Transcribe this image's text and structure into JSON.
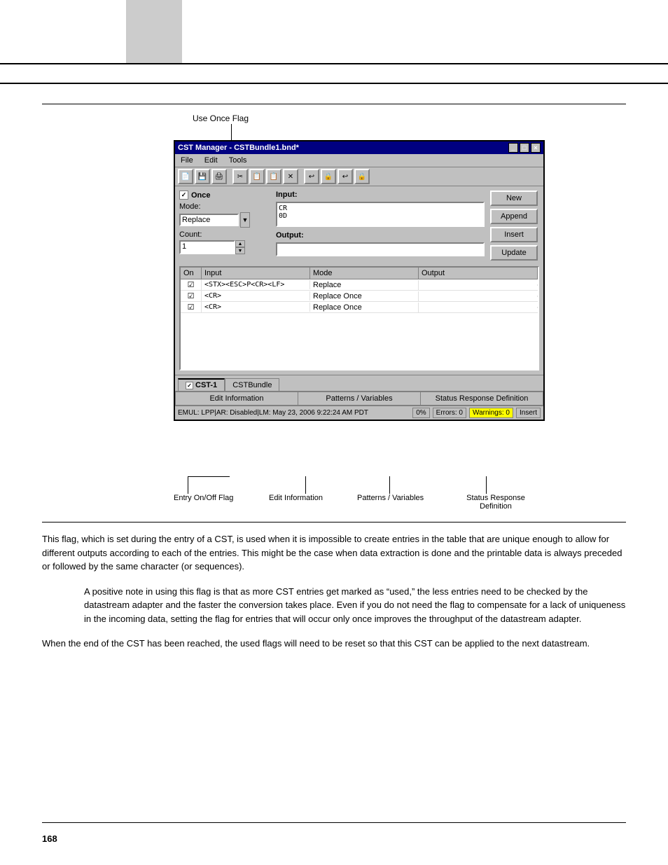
{
  "page": {
    "number": "168"
  },
  "window": {
    "title": "CST Manager - CSTBundle1.bnd*",
    "controls": [
      "_",
      "□",
      "×"
    ]
  },
  "menu": {
    "items": [
      "File",
      "Edit",
      "Tools"
    ]
  },
  "toolbar": {
    "buttons": [
      "📄",
      "💾",
      "🖨",
      "✂",
      "📋",
      "📋",
      "✕",
      "📋",
      "↩",
      "🔒"
    ]
  },
  "once_checkbox": {
    "label": "Once",
    "checked": true
  },
  "mode": {
    "label": "Mode:",
    "value": "Replace"
  },
  "count": {
    "label": "Count:",
    "value": "1"
  },
  "input_section": {
    "label": "Input:",
    "lines": [
      "CR",
      "0D"
    ]
  },
  "output_section": {
    "label": "Output:",
    "value": ""
  },
  "action_buttons": {
    "new": "New",
    "append": "Append",
    "insert": "Insert",
    "update": "Update"
  },
  "table": {
    "headers": [
      "On",
      "Input",
      "Mode",
      "Output"
    ],
    "rows": [
      {
        "on": "☑",
        "input": "<STX><ESC>P<CR><LF>",
        "mode": "Replace",
        "output": ""
      },
      {
        "on": "☑",
        "input": "<CR>",
        "mode": "Replace Once",
        "output": ""
      },
      {
        "on": "☑",
        "input": "<CR>",
        "mode": "Replace Once",
        "output": ""
      }
    ]
  },
  "tabs": [
    {
      "label": "CST-1",
      "checked": true,
      "active": true
    },
    {
      "label": "CSTBundle",
      "checked": false,
      "active": false
    }
  ],
  "bottom_tabs": [
    {
      "label": "Edit Information"
    },
    {
      "label": "Patterns / Variables"
    },
    {
      "label": "Status Response Definition"
    }
  ],
  "status_bar": {
    "text": "EMUL: LPP|AR: Disabled|LM: May 23, 2006 9:22:24 AM PDT",
    "percent": "0%",
    "errors": "Errors: 0",
    "warnings": "Warnings: 0",
    "insert": "Insert"
  },
  "annotations": {
    "use_once_flag": "Use Once Flag",
    "entry_on_off": "Entry On/Off Flag",
    "edit_information": "Edit Information",
    "patterns_variables": "Patterns / Variables",
    "status_response": "Status Response\nDefinition"
  },
  "body_text": {
    "paragraph1": "This flag, which is set during the entry of a CST, is used when it is impossible to create entries in the table that are unique enough to allow for different outputs according to each of the entries. This might be the case when data extraction is done and the printable data is always preceded or followed by the same character (or sequences).",
    "paragraph2": "A positive note in using this flag is that as more CST entries get marked as “used,” the less entries need to be checked by the datastream adapter and the faster the conversion takes place. Even if you do not need the flag to compensate for a lack of uniqueness in the incoming data, setting the flag for entries that will occur only once improves the throughput of the datastream adapter.",
    "paragraph3": "When the end of the CST has been reached, the used flags will need to be reset so that this CST can be applied to the next datastream."
  }
}
